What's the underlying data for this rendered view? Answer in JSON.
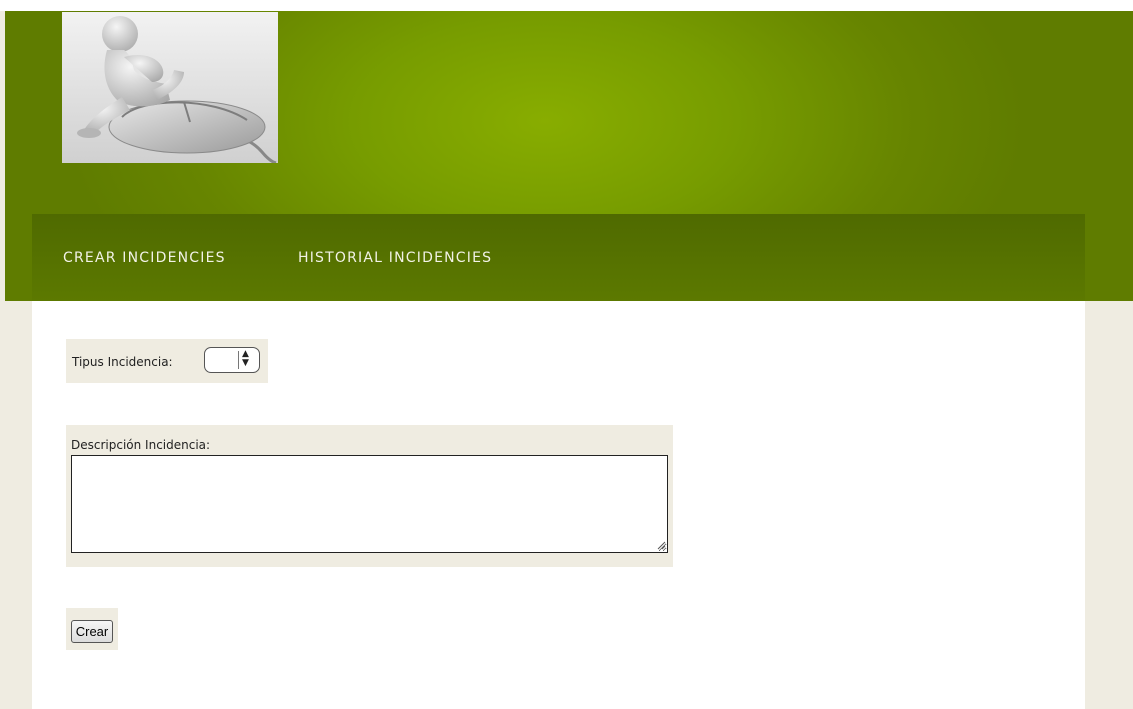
{
  "header": {
    "logo_icon": "thinking-figure-on-computer-mouse-image"
  },
  "nav": {
    "items": [
      {
        "label": "CREAR INCIDENCIES"
      },
      {
        "label": "HISTORIAL INCIDENCIES"
      }
    ]
  },
  "form": {
    "type_label": "Tipus Incidencia:",
    "type_value": "",
    "description_label": "Descripción Incidencia:",
    "description_value": "",
    "submit_label": "Crear"
  },
  "colors": {
    "header_green": "#88ad00",
    "nav_green": "#4f6a00",
    "page_beige": "#efece1"
  }
}
